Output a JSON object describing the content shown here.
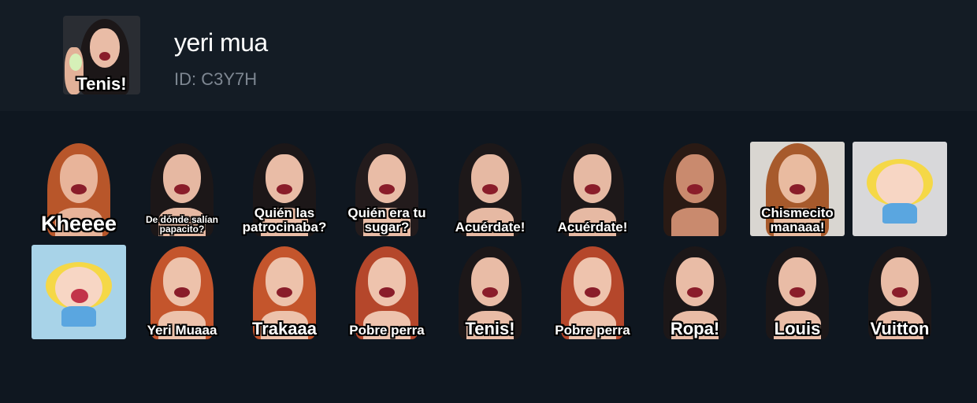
{
  "pack": {
    "title": "yeri mua",
    "id_label": "ID: C3Y7H",
    "cover_caption": "Tenis!"
  },
  "stickers": [
    {
      "caption": "Kheeee",
      "hair": "#b8562a",
      "skin": "#e8b49a",
      "bg": "none",
      "size": "xl"
    },
    {
      "caption": "De dónde salían papacito?",
      "hair": "#1c1718",
      "skin": "#e6b8a2",
      "bg": "none",
      "size": "s"
    },
    {
      "caption": "Quién las patrocinaba?",
      "hair": "#1c1718",
      "skin": "#e9bca6",
      "bg": "none",
      "size": "m"
    },
    {
      "caption": "Quién era tu sugar?",
      "hair": "#231b1c",
      "skin": "#e9bca6",
      "bg": "none",
      "size": "m"
    },
    {
      "caption": "Acuérdate!",
      "hair": "#1d1819",
      "skin": "#e6b9a3",
      "bg": "none",
      "size": "m"
    },
    {
      "caption": "Acuérdate!",
      "hair": "#1d1819",
      "skin": "#e6b9a3",
      "bg": "none",
      "size": "m"
    },
    {
      "caption": "",
      "hair": "#2a1a14",
      "skin": "#c98a6e",
      "bg": "none",
      "size": "m"
    },
    {
      "caption": "Chismecito manaaa!",
      "hair": "#a75a2c",
      "skin": "#e9bba0",
      "bg": "#d9d6d1",
      "size": "m"
    },
    {
      "caption": "",
      "hair": "#f5d847",
      "skin": "#f7d6c4",
      "bg": "#d8d8da",
      "size": "m"
    },
    {
      "caption": "",
      "hair": "#f5d847",
      "skin": "#f7d6c4",
      "bg": "#a8d3e8",
      "size": "m"
    },
    {
      "caption": "Yeri Muaaa",
      "hair": "#c4552c",
      "skin": "#edc2ab",
      "bg": "none",
      "size": "m"
    },
    {
      "caption": "Trakaaa",
      "hair": "#c4552c",
      "skin": "#edc2ab",
      "bg": "none",
      "size": "l"
    },
    {
      "caption": "Pobre perra",
      "hair": "#b5472b",
      "skin": "#eec3ad",
      "bg": "none",
      "size": "m"
    },
    {
      "caption": "Tenis!",
      "hair": "#1c1718",
      "skin": "#e9bca6",
      "bg": "none",
      "size": "l"
    },
    {
      "caption": "Pobre perra",
      "hair": "#b5472b",
      "skin": "#eec3ad",
      "bg": "none",
      "size": "m"
    },
    {
      "caption": "Ropa!",
      "hair": "#1c1718",
      "skin": "#e9bca6",
      "bg": "none",
      "size": "l"
    },
    {
      "caption": "Louis",
      "hair": "#1c1718",
      "skin": "#e9bca6",
      "bg": "none",
      "size": "l"
    },
    {
      "caption": "Vuitton",
      "hair": "#1c1718",
      "skin": "#e9bca6",
      "bg": "none",
      "size": "l"
    }
  ]
}
